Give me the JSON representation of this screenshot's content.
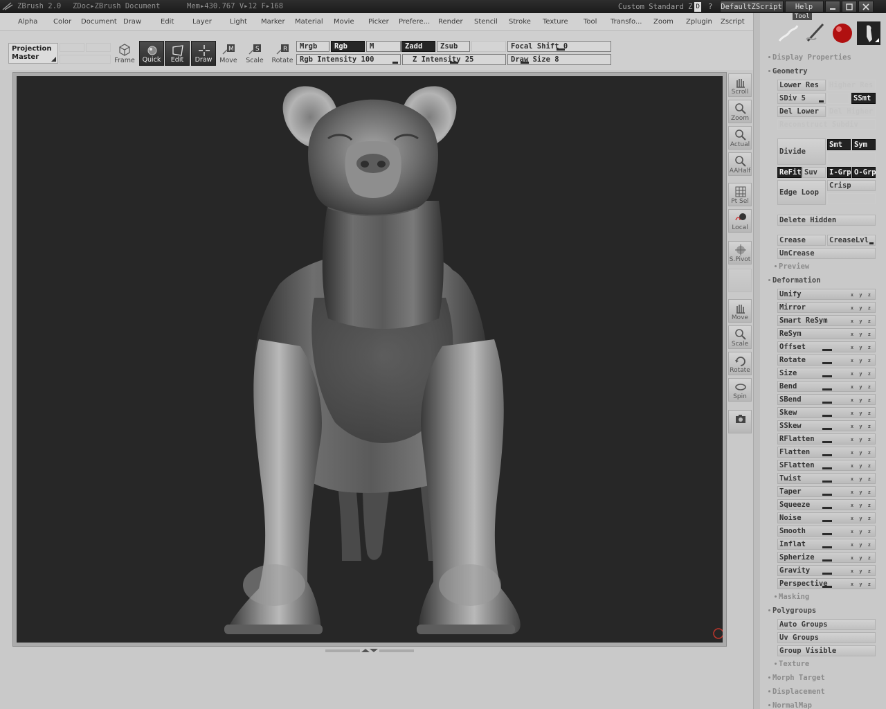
{
  "titlebar": {
    "app": "ZBrush 2.0",
    "doc": "ZDoc▸ZBrush Document",
    "mem": "Mem▸430.767  V▸12  F▸168",
    "layout": "Custom  Standard  Z",
    "layout_badge": "D",
    "qmark": "?",
    "script": "DefaultZScript",
    "help": "Help"
  },
  "menu": [
    "Alpha",
    "Color",
    "Document",
    "Draw",
    "Edit",
    "Layer",
    "Light",
    "Marker",
    "Material",
    "Movie",
    "Picker",
    "Prefere...",
    "Render",
    "Stencil",
    "Stroke",
    "Texture",
    "Tool",
    "Transfo...",
    "Zoom",
    "Zplugin",
    "Zscript"
  ],
  "toolbar": {
    "projection_master": "Projection Master",
    "frame": "Frame",
    "quick": "Quick",
    "edit": "Edit",
    "draw": "Draw",
    "move": "Move",
    "scale": "Scale",
    "rotate": "Rotate",
    "mrgb": "Mrgb",
    "rgb": "Rgb",
    "m": "M",
    "zadd": "Zadd",
    "zsub": "Zsub",
    "focal_shift": "Focal Shift 0",
    "rgb_intensity": "Rgb Intensity 100",
    "z_intensity": "Z Intensity 25",
    "draw_size": "Draw Size 8"
  },
  "dock": {
    "scroll": "Scroll",
    "zoom": "Zoom",
    "actual": "Actual",
    "aahalf": "AAHalf",
    "ptsel": "Pt Sel",
    "local": "Local",
    "spivot": "S.Pivot",
    "move": "Move",
    "scale": "Scale",
    "rotate": "Rotate",
    "spin": "Spin"
  },
  "palette": {
    "tool_label": "Tool",
    "display_properties": "Display Properties",
    "geometry": "Geometry",
    "lower_res": "Lower Res",
    "higher_res": "Higher Res",
    "sdiv": "SDiv 5",
    "ssmt": "SSmt",
    "del_lower": "Del Lower",
    "del_higher": "Del Higher",
    "reconstruct": "Reconstruct Subdiv",
    "divide": "Divide",
    "smt": "Smt",
    "sym": "Sym",
    "refit": "ReFit",
    "suv": "Suv",
    "igrp": "I-Grp",
    "ogrp": "O-Grp",
    "edge_loop": "Edge Loop",
    "crisp": "Crisp",
    "delete_hidden": "Delete Hidden",
    "crease": "Crease",
    "crease_lvl": "CreaseLvl",
    "uncrease": "UnCrease",
    "preview": "Preview",
    "deformation": "Deformation",
    "deform_items": [
      "Unify",
      "Mirror",
      "Smart ReSym",
      "ReSym",
      "Offset",
      "Rotate",
      "Size",
      "Bend",
      "SBend",
      "Skew",
      "SSkew",
      "RFlatten",
      "Flatten",
      "SFlatten",
      "Twist",
      "Taper",
      "Squeeze",
      "Noise",
      "Smooth",
      "Inflat",
      "Spherize",
      "Gravity",
      "Perspective"
    ],
    "axes": "x y z",
    "masking": "Masking",
    "polygroups": "Polygroups",
    "auto_groups": "Auto Groups",
    "uv_groups": "Uv Groups",
    "group_visible": "Group Visible",
    "texture": "Texture",
    "morph_target": "Morph Target",
    "displacement": "Displacement",
    "normalmap": "NormalMap"
  }
}
